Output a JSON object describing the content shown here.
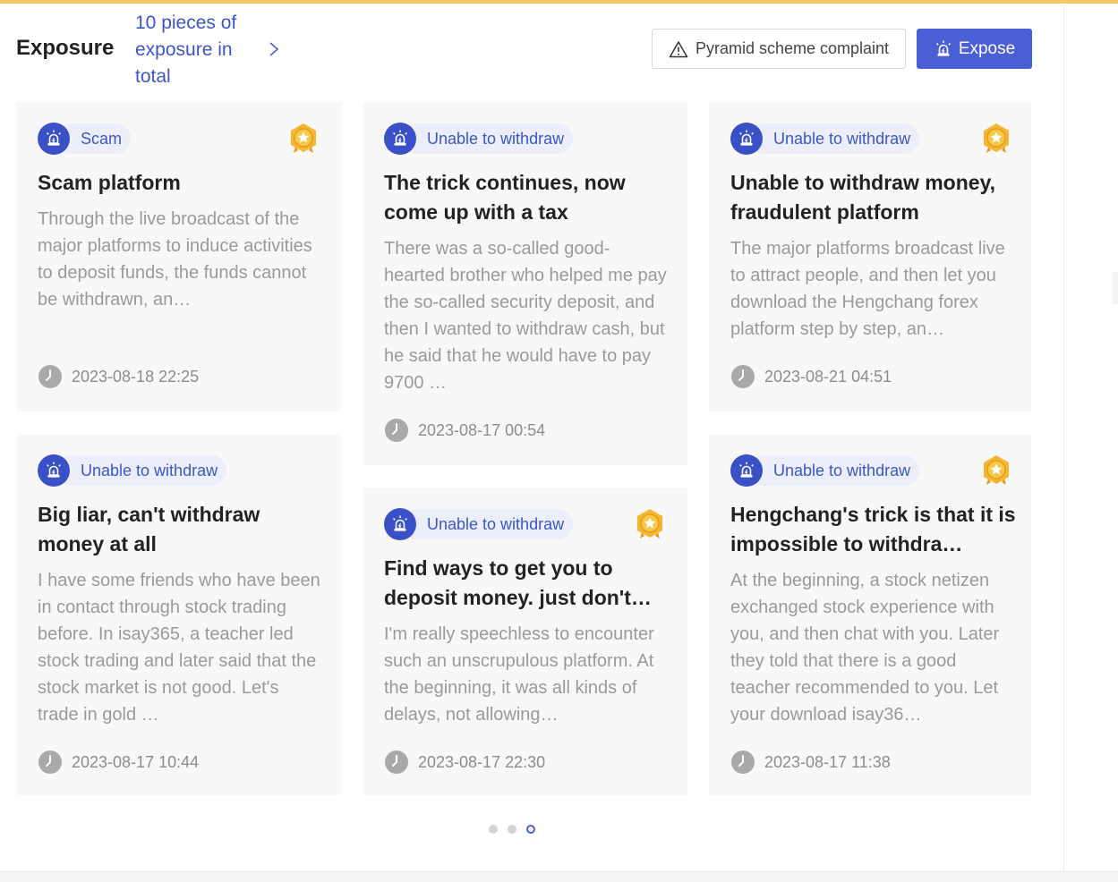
{
  "header": {
    "title": "Exposure",
    "count_text": "10 pieces of exposure in total",
    "complaint_label": "Pyramid scheme complaint",
    "expose_label": "Expose"
  },
  "cards": [
    {
      "tag": "Scam",
      "title": "Scam platform",
      "description": "Through the live broadcast of the major platforms to induce activities to deposit funds, the funds cannot be withdrawn, an…",
      "time": "2023-08-18 22:25",
      "medal": true
    },
    {
      "tag": "Unable to withdraw",
      "title": "The trick continues, now come up with a tax",
      "description": "There was a so-called good-hearted brother who helped me pay the so-called security deposit, and then I wanted to withdraw cash, but he said that he would have to pay 9700 …",
      "time": "2023-08-17 00:54",
      "medal": false
    },
    {
      "tag": "Unable to withdraw",
      "title": "Unable to withdraw money, fraudulent platform",
      "description": "The major platforms broadcast live to attract people, and then let you download the Hengchang forex platform step by step, an…",
      "time": "2023-08-21 04:51",
      "medal": true
    },
    {
      "tag": "Unable to withdraw",
      "title": "Big liar, can't withdraw money at all",
      "description": "I have some friends who have been in contact through stock trading before. In isay365, a teacher led stock trading and later said that the stock market is not good. Let's trade in gold …",
      "time": "2023-08-17 10:44",
      "medal": false
    },
    {
      "tag": "Unable to withdraw",
      "title": "Find ways to get you to deposit money. just don't…",
      "description": "I'm really speechless to encounter such an unscrupulous platform. At the beginning, it was all kinds of delays, not allowing…",
      "time": "2023-08-17 22:30",
      "medal": true
    },
    {
      "tag": "Unable to withdraw",
      "title": "Hengchang's trick is that it is impossible to withdra…",
      "description": "At the beginning, a stock netizen exchanged stock experience with you, and then chat with you. Later they told that there is a good teacher recommended to you. Let your download isay36…",
      "time": "2023-08-17 11:38",
      "medal": true
    }
  ],
  "pagination": {
    "total": 3,
    "active": 3
  },
  "colors": {
    "accent": "#4a5ed6",
    "tag_bg": "#eceffa",
    "top_bar": "#f6c85f"
  },
  "icons": {
    "tag": "alarm-icon",
    "medal": "gold-medal-icon",
    "time": "clock-icon",
    "complaint": "warning-icon",
    "expose": "alarm-icon",
    "more": "chevron-right-icon"
  }
}
